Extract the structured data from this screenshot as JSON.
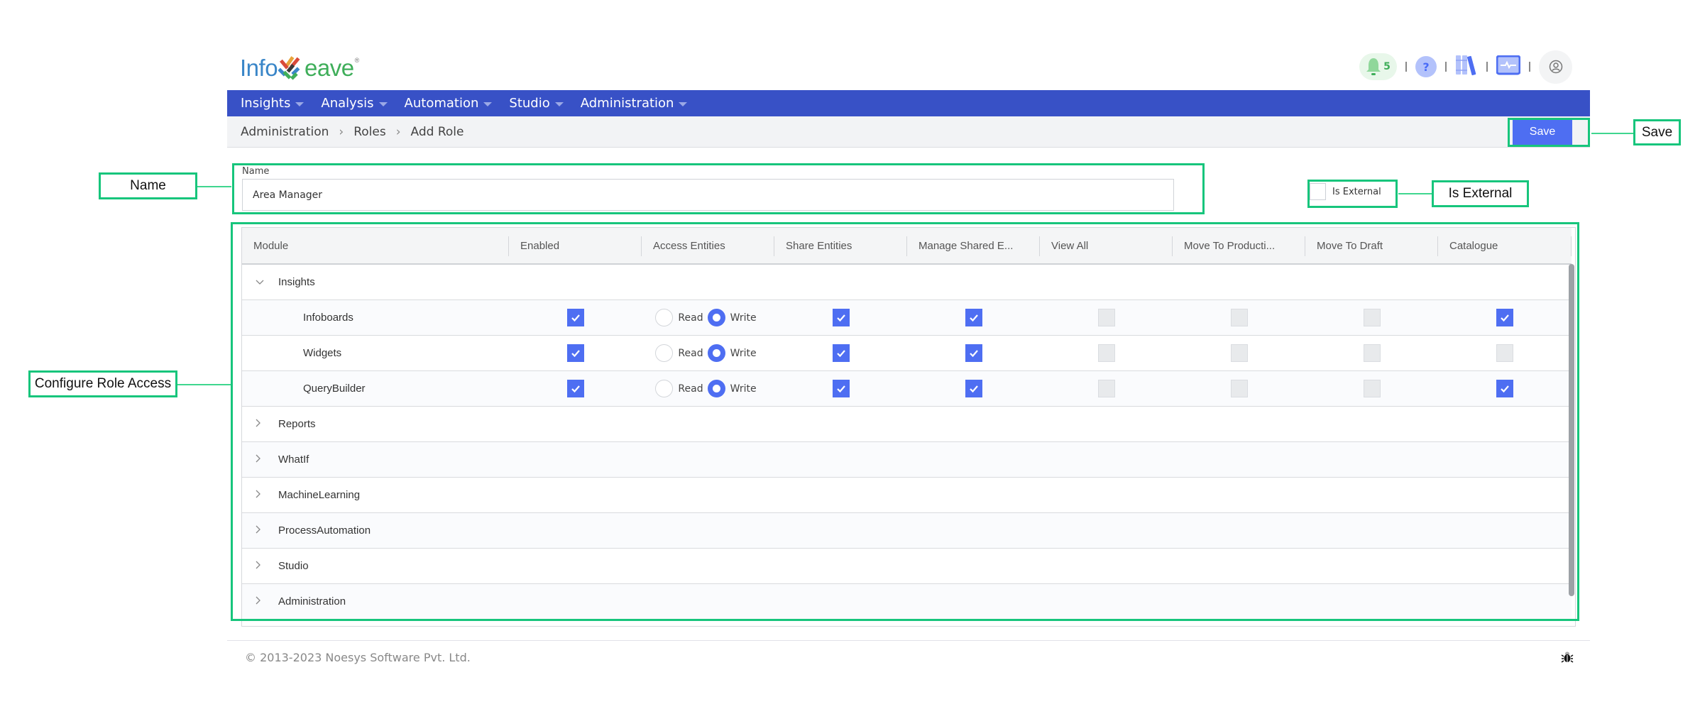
{
  "logo": {
    "part1": "Info",
    "part2": "eave",
    "reg": "®"
  },
  "header": {
    "notification_count": "5",
    "help_glyph": "?",
    "icons": [
      "bell-icon",
      "help-icon",
      "library-icon",
      "monitor-icon",
      "user-avatar-icon"
    ]
  },
  "nav": {
    "items": [
      {
        "label": "Insights"
      },
      {
        "label": "Analysis"
      },
      {
        "label": "Automation"
      },
      {
        "label": "Studio"
      },
      {
        "label": "Administration"
      }
    ]
  },
  "breadcrumb": {
    "items": [
      "Administration",
      "Roles",
      "Add Role"
    ],
    "separator": "›"
  },
  "toolbar": {
    "save_label": "Save"
  },
  "form": {
    "name_label": "Name",
    "name_value": "Area Manager",
    "is_external_label": "Is External",
    "is_external_checked": false
  },
  "table": {
    "columns": [
      "Module",
      "Enabled",
      "Access Entities",
      "Share Entities",
      "Manage Shared E...",
      "View All",
      "Move To Producti...",
      "Move To Draft",
      "Catalogue"
    ],
    "radio_labels": {
      "read": "Read",
      "write": "Write"
    },
    "modules": [
      {
        "name": "Insights",
        "expanded": true,
        "children": [
          {
            "name": "Infoboards",
            "enabled": true,
            "access": "Write",
            "share": true,
            "manage_shared": true,
            "view_all": false,
            "move_to_production": false,
            "move_to_draft": false,
            "catalogue": true
          },
          {
            "name": "Widgets",
            "enabled": true,
            "access": "Write",
            "share": true,
            "manage_shared": true,
            "view_all": false,
            "move_to_production": false,
            "move_to_draft": false,
            "catalogue": false
          },
          {
            "name": "QueryBuilder",
            "enabled": true,
            "access": "Write",
            "share": true,
            "manage_shared": true,
            "view_all": false,
            "move_to_production": false,
            "move_to_draft": false,
            "catalogue": true
          }
        ]
      },
      {
        "name": "Reports",
        "expanded": false
      },
      {
        "name": "WhatIf",
        "expanded": false
      },
      {
        "name": "MachineLearning",
        "expanded": false
      },
      {
        "name": "ProcessAutomation",
        "expanded": false
      },
      {
        "name": "Studio",
        "expanded": false
      },
      {
        "name": "Administration",
        "expanded": false
      }
    ]
  },
  "footer": {
    "copyright": "© 2013-2023 Noesys Software Pvt. Ltd."
  },
  "annotations": {
    "name": "Name",
    "save": "Save",
    "is_external": "Is External",
    "configure": "Configure Role Access"
  },
  "colors": {
    "nav": "#3851c6",
    "accent": "#4e6ef2",
    "annotation": "#17c57c",
    "logo_blue": "#3a86c8",
    "logo_green": "#3fae5a"
  }
}
